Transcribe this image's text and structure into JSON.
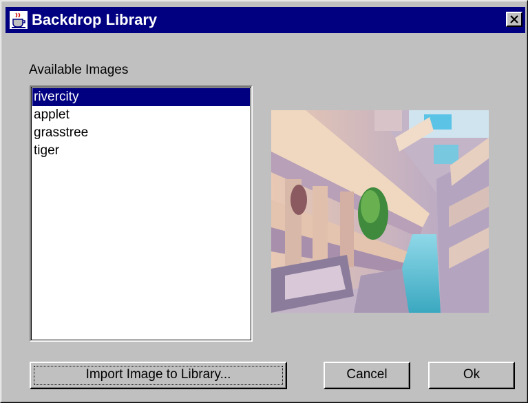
{
  "window": {
    "title": "Backdrop Library",
    "icon": "java-cup-icon",
    "close_icon": "close-icon"
  },
  "images_section": {
    "label": "Available Images",
    "items": [
      {
        "label": "rivercity",
        "selected": true
      },
      {
        "label": "applet",
        "selected": false
      },
      {
        "label": "grasstree",
        "selected": false
      },
      {
        "label": "tiger",
        "selected": false
      }
    ]
  },
  "preview": {
    "image": "rivercity"
  },
  "buttons": {
    "import_label": "Import Image to Library...",
    "cancel_label": "Cancel",
    "ok_label": "Ok"
  },
  "colors": {
    "titlebar": "#000080",
    "dialog_bg": "#c0c0c0",
    "selection": "#000080"
  }
}
